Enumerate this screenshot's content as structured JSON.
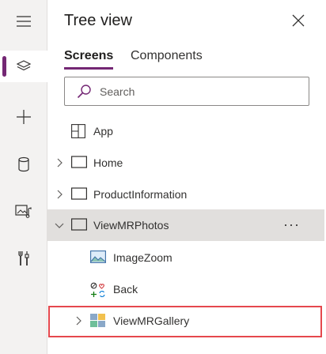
{
  "rail": {
    "items": [
      {
        "name": "hamburger-menu-icon"
      },
      {
        "name": "tree-view-layers-icon"
      },
      {
        "name": "insert-plus-icon"
      },
      {
        "name": "data-cylinder-icon"
      },
      {
        "name": "media-icon"
      },
      {
        "name": "advanced-tools-icon"
      }
    ],
    "accent": "#742774"
  },
  "panel": {
    "title": "Tree view",
    "tabs": [
      {
        "label": "Screens",
        "selected": true
      },
      {
        "label": "Components",
        "selected": false
      }
    ],
    "search": {
      "placeholder": "Search",
      "value": ""
    },
    "tree": [
      {
        "label": "App",
        "icon": "app-icon",
        "expandable": false
      },
      {
        "label": "Home",
        "icon": "screen-icon",
        "expandable": true,
        "expanded": false
      },
      {
        "label": "ProductInformation",
        "icon": "screen-icon",
        "expandable": true,
        "expanded": false
      },
      {
        "label": "ViewMRPhotos",
        "icon": "screen-icon",
        "expandable": true,
        "expanded": true,
        "selected": true,
        "more": "···"
      },
      {
        "label": "ImageZoom",
        "icon": "image-icon",
        "expandable": false
      },
      {
        "label": "Back",
        "icon": "controls-icon",
        "expandable": false
      },
      {
        "label": "ViewMRGallery",
        "icon": "gallery-icon",
        "expandable": true,
        "expanded": false,
        "highlighted": true
      }
    ],
    "highlight_color": "#e5484d"
  }
}
